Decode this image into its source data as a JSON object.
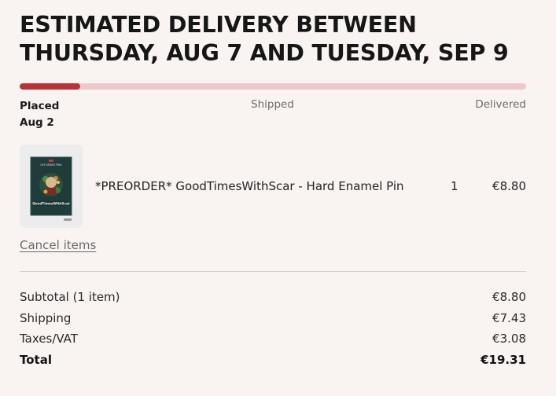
{
  "delivery": {
    "headline": "ESTIMATED DELIVERY BETWEEN THURSDAY, AUG 7 AND TUESDAY, SEP 9"
  },
  "progress": {
    "fraction": 0.12,
    "fill_color": "#b8323a",
    "track_color": "#ecc9cb",
    "steps": {
      "placed_label": "Placed",
      "placed_date": "Aug 2",
      "shipped_label": "Shipped",
      "delivered_label": "Delivered"
    }
  },
  "item": {
    "image_icon": "enamel-pin-card-image",
    "image_caption_small": "LIFE SERIES PINS",
    "image_caption_name": "GoodTimesWithScar",
    "name": "*PREORDER* GoodTimesWithScar - Hard Enamel Pin",
    "quantity": "1",
    "price": "€8.80"
  },
  "actions": {
    "cancel_label": "Cancel items"
  },
  "summary": {
    "subtotal_label": "Subtotal (1 item)",
    "subtotal_value": "€8.80",
    "shipping_label": "Shipping",
    "shipping_value": "€7.43",
    "taxes_label": "Taxes/VAT",
    "taxes_value": "€3.08",
    "total_label": "Total",
    "total_value": "€19.31"
  },
  "colors": {
    "background": "#f9f3f1",
    "accent": "#b8323a"
  }
}
